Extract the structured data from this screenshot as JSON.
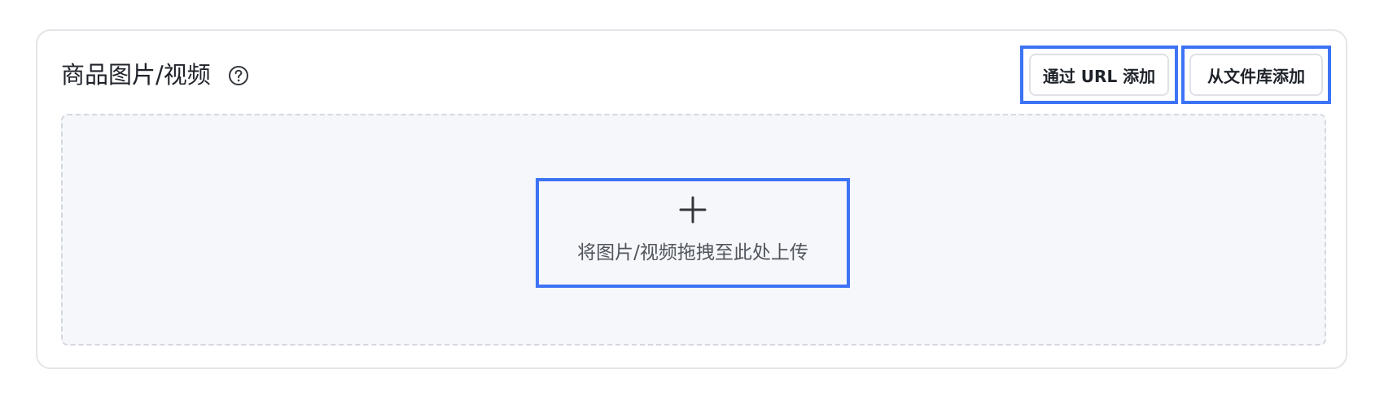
{
  "section": {
    "title": "商品图片/视频",
    "help_icon": "question-circle-icon"
  },
  "actions": {
    "add_by_url_label": "通过 URL 添加",
    "add_from_library_label": "从文件库添加"
  },
  "dropzone": {
    "icon": "plus-icon",
    "hint": "将图片/视频拖拽至此处上传"
  },
  "colors": {
    "highlight": "#3d73f5",
    "dropzone_bg": "#f6f7fa",
    "border": "#e3e5e8"
  }
}
